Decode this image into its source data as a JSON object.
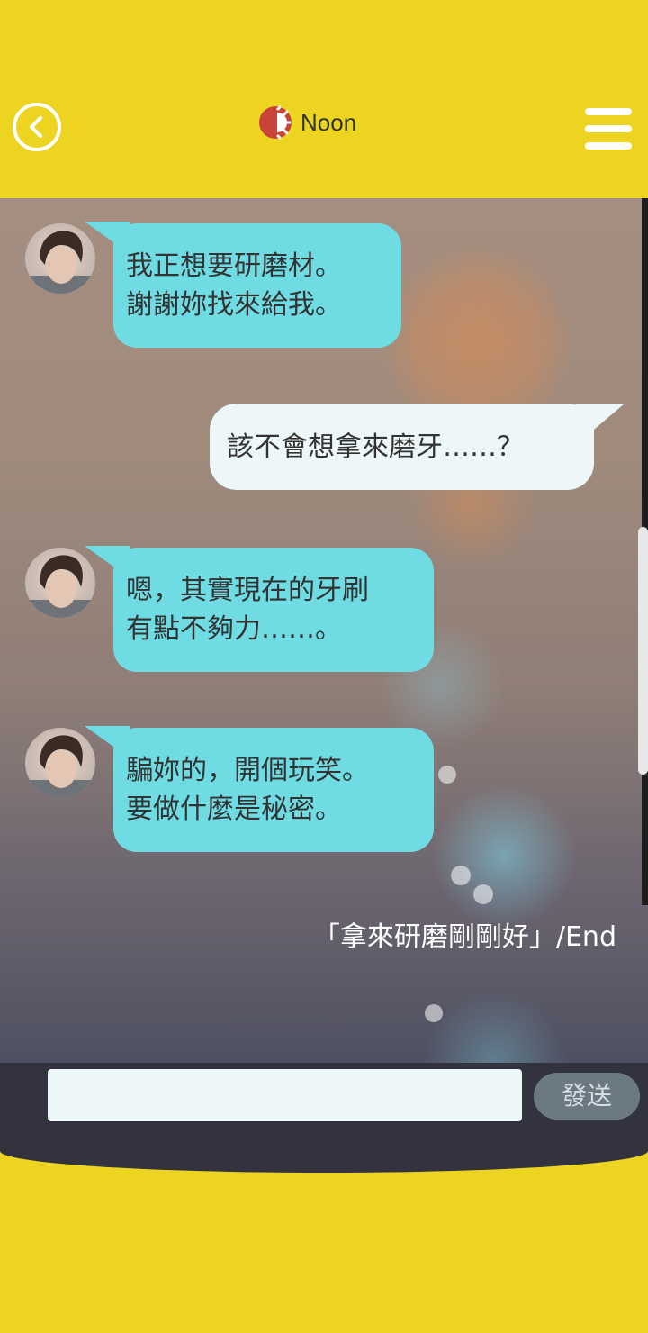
{
  "header": {
    "title": "Noon",
    "time_icon": "sun-half-icon",
    "back_icon": "chevron-left-icon",
    "menu_icon": "hamburger-menu-icon"
  },
  "messages": [
    {
      "side": "left",
      "lines": [
        "我正想要研磨材。",
        "謝謝妳找來給我。"
      ]
    },
    {
      "side": "right",
      "lines": [
        "該不會想拿來磨牙……？"
      ]
    },
    {
      "side": "left",
      "lines": [
        "嗯，其實現在的牙刷",
        "有點不夠力……。"
      ]
    },
    {
      "side": "left",
      "lines": [
        "騙妳的，開個玩笑。",
        "要做什麼是秘密。"
      ]
    }
  ],
  "end_text": "「拿來研磨剛剛好」/End",
  "composer": {
    "input_value": "",
    "send_label": "發送"
  },
  "colors": {
    "brand_yellow": "#ecd421",
    "left_bubble": "#6fdbe3",
    "right_bubble": "#eef7f7",
    "composer_bg": "#33323f",
    "send_button": "#6b7a82"
  }
}
